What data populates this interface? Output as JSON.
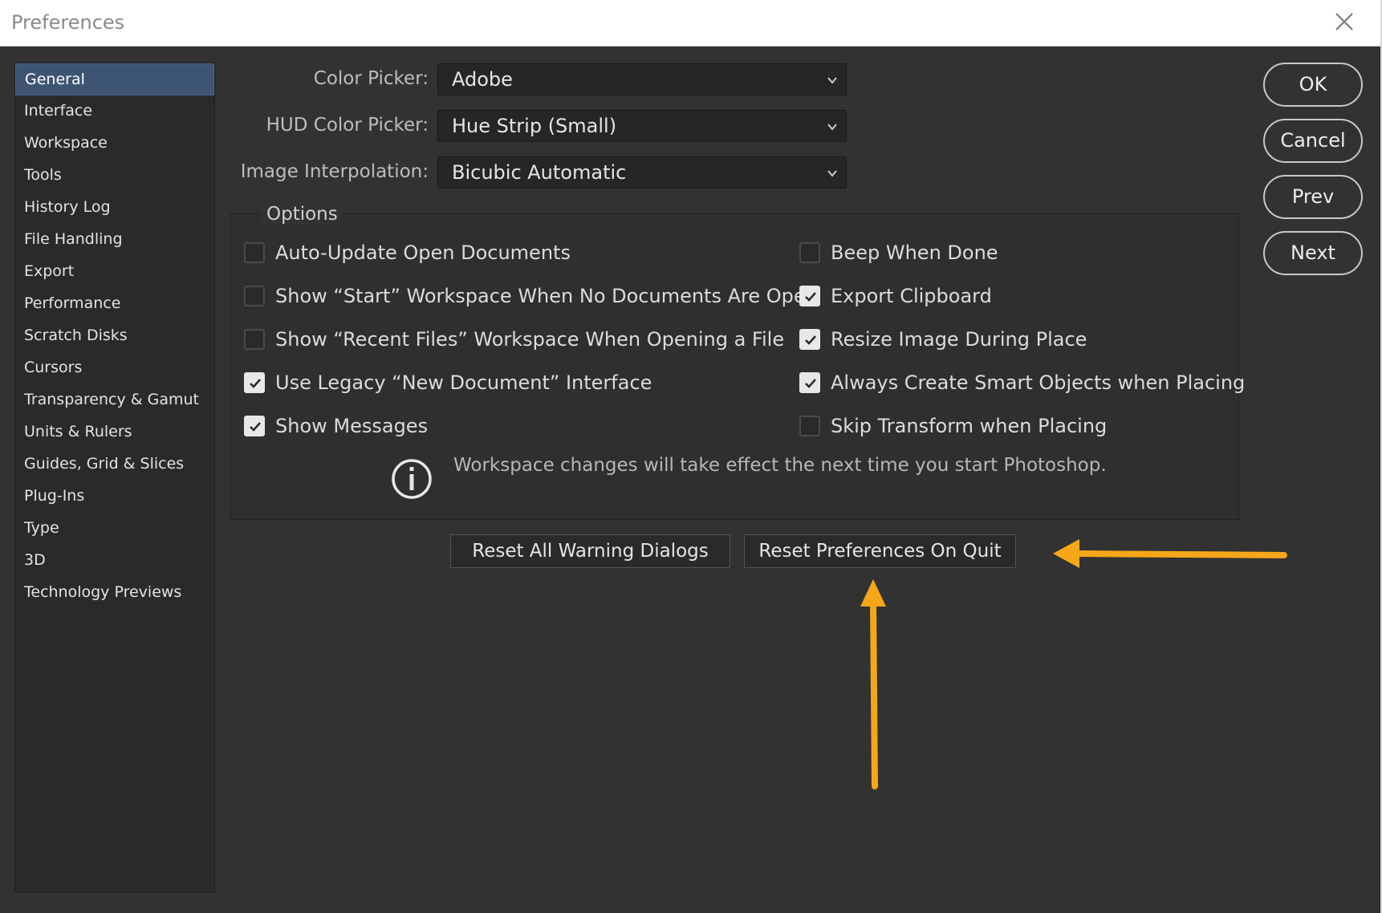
{
  "window": {
    "title": "Preferences"
  },
  "sidebar": {
    "items": [
      {
        "label": "General"
      },
      {
        "label": "Interface"
      },
      {
        "label": "Workspace"
      },
      {
        "label": "Tools"
      },
      {
        "label": "History Log"
      },
      {
        "label": "File Handling"
      },
      {
        "label": "Export"
      },
      {
        "label": "Performance"
      },
      {
        "label": "Scratch Disks"
      },
      {
        "label": "Cursors"
      },
      {
        "label": "Transparency & Gamut"
      },
      {
        "label": "Units & Rulers"
      },
      {
        "label": "Guides, Grid & Slices"
      },
      {
        "label": "Plug-Ins"
      },
      {
        "label": "Type"
      },
      {
        "label": "3D"
      },
      {
        "label": "Technology Previews"
      }
    ],
    "selected": "General"
  },
  "general": {
    "color_picker": {
      "label": "Color Picker:",
      "value": "Adobe"
    },
    "hud_color_picker": {
      "label": "HUD Color Picker:",
      "value": "Hue Strip (Small)"
    },
    "image_interpolation": {
      "label": "Image Interpolation:",
      "value": "Bicubic Automatic"
    }
  },
  "options": {
    "legend": "Options",
    "left": [
      {
        "label": "Auto-Update Open Documents",
        "checked": false
      },
      {
        "label": "Show “Start” Workspace When No Documents Are Open",
        "checked": false
      },
      {
        "label": "Show “Recent Files” Workspace When Opening a File",
        "checked": false
      },
      {
        "label": "Use Legacy “New Document” Interface",
        "checked": true
      },
      {
        "label": "Show Messages",
        "checked": true
      }
    ],
    "right": [
      {
        "label": "Beep When Done",
        "checked": false
      },
      {
        "label": "Export Clipboard",
        "checked": true
      },
      {
        "label": "Resize Image During Place",
        "checked": true
      },
      {
        "label": "Always Create Smart Objects when Placing",
        "checked": true
      },
      {
        "label": "Skip Transform when Placing",
        "checked": false
      }
    ],
    "info": "Workspace changes will take effect the next time you start Photoshop."
  },
  "actions": {
    "reset_warnings": "Reset All Warning Dialogs",
    "reset_prefs": "Reset Preferences On Quit"
  },
  "dialog_buttons": {
    "ok": "OK",
    "cancel": "Cancel",
    "prev": "Prev",
    "next": "Next"
  },
  "annotation": {
    "arrow_color": "#f5a719"
  }
}
